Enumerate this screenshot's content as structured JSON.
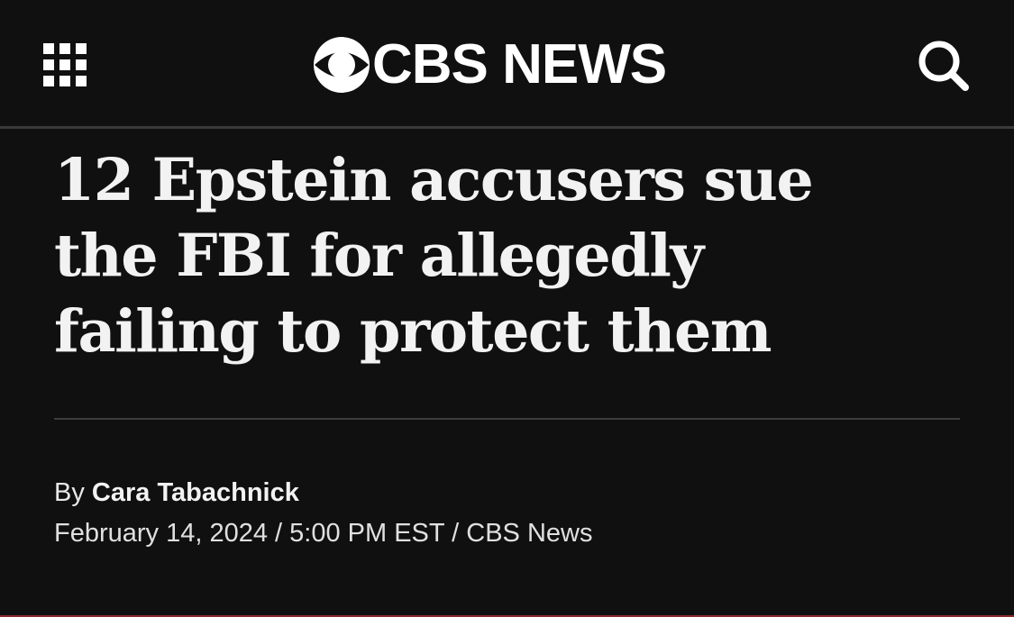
{
  "header": {
    "logo_text": "CBS NEWS",
    "menu_icon": "grid-menu-icon",
    "logo_icon": "cbs-eye-icon",
    "search_icon": "search-icon"
  },
  "article": {
    "headline_lines": [
      "12 Epstein accusers sue",
      "the FBI for allegedly",
      "failing to protect them"
    ],
    "byline_prefix": "By ",
    "author": "Cara Tabachnick",
    "date": "February 14, 2024",
    "separator": " / ",
    "time": "5:00 PM EST",
    "source": "CBS News"
  },
  "colors": {
    "background": "#101010",
    "text": "#f2f2f2",
    "divider": "#3c3c3c"
  }
}
